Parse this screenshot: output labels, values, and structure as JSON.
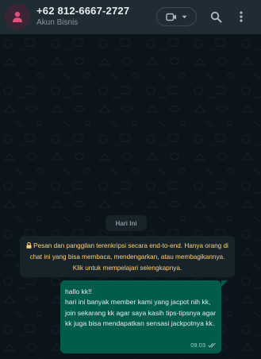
{
  "header": {
    "title": "+62 812-6667-2727",
    "subtitle": "Akun Bisnis",
    "icons": [
      "person-icon",
      "video-call-icon",
      "chevron-down-icon",
      "search-icon",
      "more-vert-icon"
    ]
  },
  "chat": {
    "date_label": "Hari Ini",
    "encryption_notice": "Pesan dan panggilan terenkripsi secara end-to-end. Hanya orang di chat ini yang bisa membaca, mendengarkan, atau membagikannya. Klik untuk mempelajari selengkapnya.",
    "messages": [
      {
        "direction": "outgoing",
        "text": "hallo kk!!\nhari ini banyak member kami yang jacpot nih kk,\njoin sekarang kk agar saya kasih tips-tipsnya agar kk juga bisa mendapatkan sensasi jackpotnya kk.",
        "time": "09.03",
        "status": "delivered"
      }
    ]
  },
  "colors": {
    "header_bg": "#1f2c34",
    "chat_bg": "#0b141a",
    "outgoing_bubble": "#005c4b",
    "notice_text": "#ffd279",
    "avatar_icon": "#e2507f"
  }
}
